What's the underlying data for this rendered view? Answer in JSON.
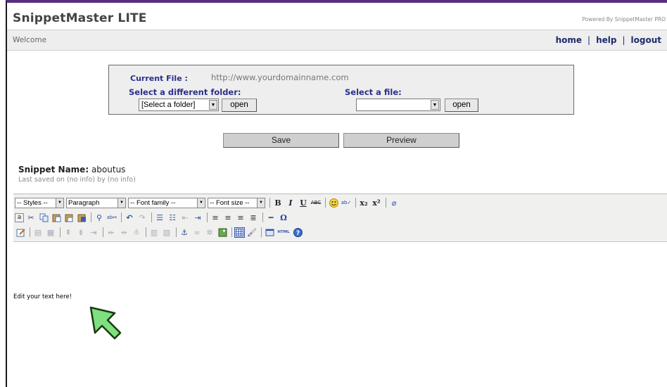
{
  "app": {
    "title": "SnippetMaster LITE",
    "powered_by": "Powered By SnippetMaster PRO"
  },
  "nav": {
    "welcome": "Welcome",
    "home": "home",
    "help": "help",
    "logout": "logout",
    "separator": "|"
  },
  "file_panel": {
    "current_file_label": "Current File :",
    "current_file_value": "http://www.yourdomainname.com",
    "folder_label": "Select a different folder:",
    "folder_select_value": "[Select a folder]",
    "folder_open": "open",
    "file_label": "Select a file:",
    "file_select_value": "",
    "file_open": "open"
  },
  "actions": {
    "save": "Save",
    "preview": "Preview"
  },
  "snippet": {
    "name_label": "Snippet Name:",
    "name_value": "aboutus",
    "last_saved": "Last saved on (no info) by (no info)"
  },
  "toolbar": {
    "styles": "-- Styles --",
    "paragraph": "Paragraph",
    "font_family": "-- Font family --",
    "font_size": "-- Font size --",
    "bold": "B",
    "italic": "I",
    "underline": "U",
    "strike": "ABC",
    "subscript": "x₂",
    "superscript": "x²",
    "omega": "Ω",
    "html": "HTML"
  },
  "editor": {
    "content_text": "Edit your text here!"
  },
  "colors": {
    "header_border": "#5a2d82",
    "link_blue": "#1e2a6b",
    "label_blue": "#2b2f8a",
    "cursor_green": "#7ee07e"
  }
}
